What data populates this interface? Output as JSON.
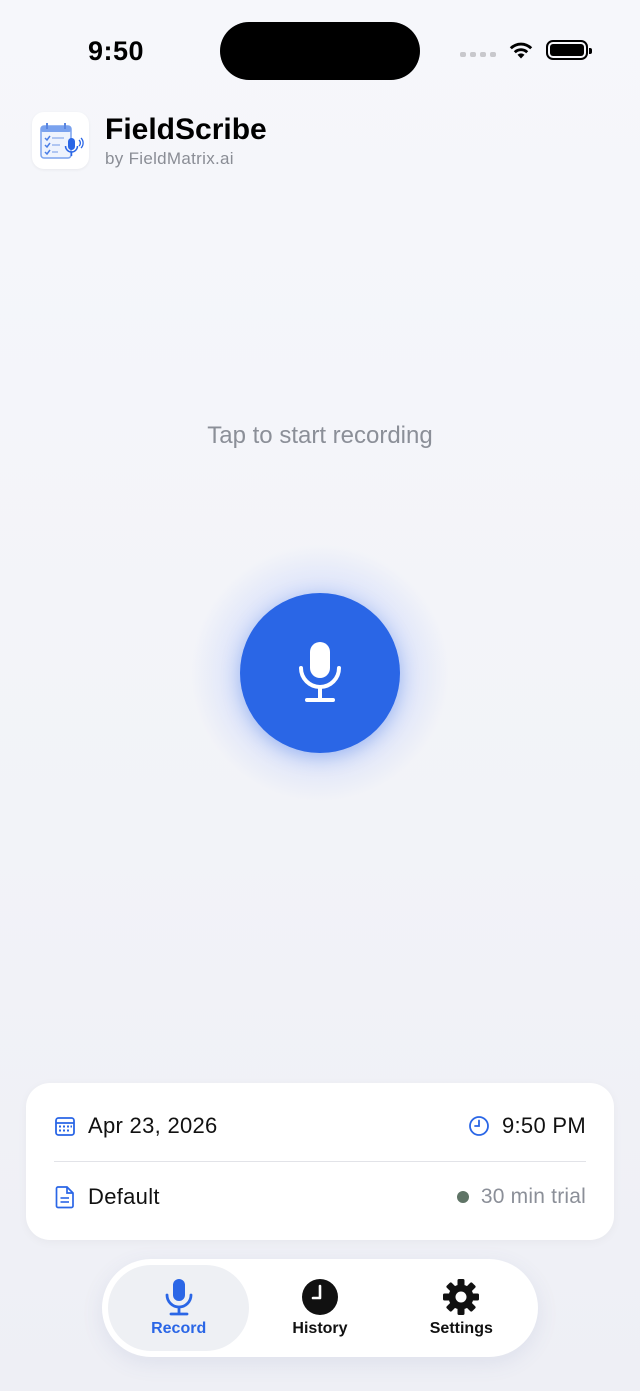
{
  "status_bar": {
    "time": "9:50"
  },
  "header": {
    "title": "FieldScribe",
    "subtitle": "by FieldMatrix.ai"
  },
  "main": {
    "prompt": "Tap to start recording"
  },
  "info": {
    "date": "Apr 23, 2026",
    "time": "9:50 PM",
    "template": "Default",
    "trial": "30 min trial"
  },
  "tabs": [
    {
      "label": "Record",
      "icon": "mic-icon",
      "active": true
    },
    {
      "label": "History",
      "icon": "clock-icon",
      "active": false
    },
    {
      "label": "Settings",
      "icon": "gear-icon",
      "active": false
    }
  ],
  "colors": {
    "accent": "#2a66e6",
    "trial_dot": "#5f7466"
  }
}
